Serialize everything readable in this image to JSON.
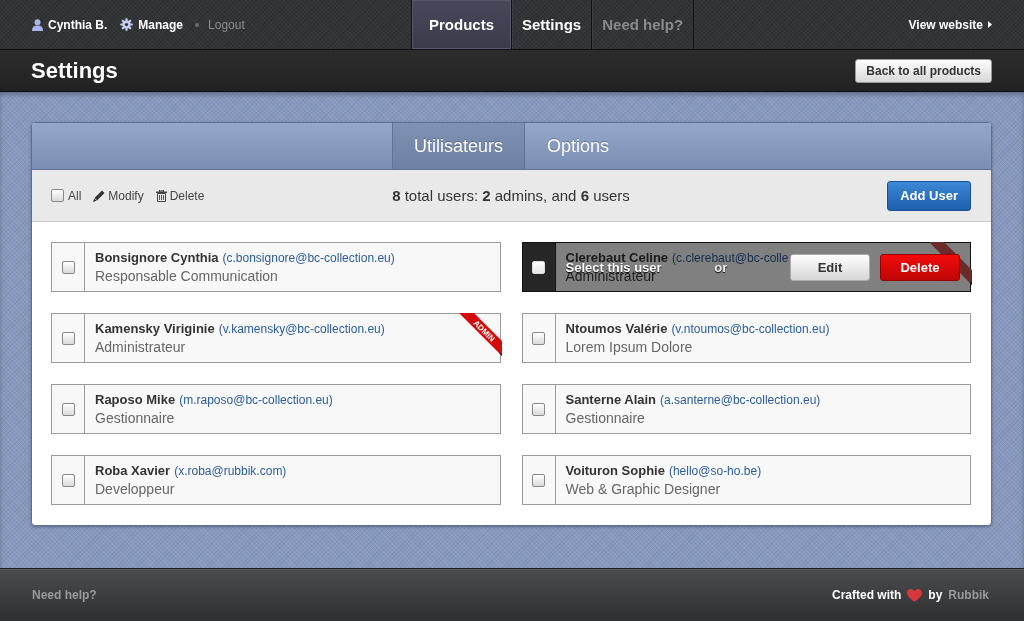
{
  "top_bar": {
    "user": "Cynthia B.",
    "manage": "Manage",
    "logout": "Logout",
    "nav_tabs": [
      {
        "label": "Products",
        "selected": true,
        "muted": false
      },
      {
        "label": "Settings",
        "selected": false,
        "muted": false
      },
      {
        "label": "Need help?",
        "selected": false,
        "muted": true
      }
    ],
    "view_website": "View website"
  },
  "header": {
    "title": "Settings",
    "back_button": "Back to all products"
  },
  "panel": {
    "tabs": [
      {
        "label": "Utilisateurs",
        "selected": true
      },
      {
        "label": "Options",
        "selected": false
      }
    ],
    "toolbar": {
      "select_all": {
        "label": "All",
        "checked": false
      },
      "actions": [
        {
          "kind": "modify",
          "label": "Modify"
        },
        {
          "kind": "delete",
          "label": "Delete"
        }
      ],
      "summary": "**8** total users: **2** admins, and **6** users",
      "add_button": "Add User"
    },
    "users": [
      {
        "name": "Bonsignore Cynthia",
        "email": "(c.bonsignore@bc-collection.eu)",
        "role": "Responsable Communication",
        "checked": false,
        "admin": false
      },
      {
        "name": "Clerebaut Celine",
        "email": "(c.clerebaut@bc-colle",
        "role": "Administrateur",
        "checked": false,
        "admin": true,
        "hover": {
          "label": "Select this user",
          "separator": "or",
          "buttons": [
            {
              "kind": "edit",
              "label": "Edit"
            },
            {
              "kind": "delete",
              "label": "Delete"
            }
          ]
        }
      },
      {
        "name": "Kamensky Viriginie",
        "email": "(v.kamensky@bc-collection.eu)",
        "role": "Administrateur",
        "checked": false,
        "admin": true,
        "badge": "ADMIN"
      },
      {
        "name": "Ntoumos Valérie",
        "email": "(v.ntoumos@bc-collection.eu)",
        "role": "Lorem Ipsum Dolore",
        "checked": false,
        "admin": false
      },
      {
        "name": "Raposo Mike",
        "email": "(m.raposo@bc-collection.eu)",
        "role": "Gestionnaire",
        "checked": false,
        "admin": false
      },
      {
        "name": "Santerne Alain",
        "email": "(a.santerne@bc-collection.eu)",
        "role": "Gestionnaire",
        "checked": false,
        "admin": false
      },
      {
        "name": "Roba Xavier",
        "email": "(x.roba@rubbik.com)",
        "role": "Developpeur",
        "checked": false,
        "admin": false
      },
      {
        "name": "Voituron Sophie",
        "email": "(hello@so-ho.be)",
        "role": "Web & Graphic Designer",
        "checked": false,
        "admin": false
      }
    ]
  },
  "footer": {
    "help": "Need help?",
    "credit_prefix": "Crafted with",
    "credit_by": "by",
    "credit_name": "Rubbik"
  }
}
